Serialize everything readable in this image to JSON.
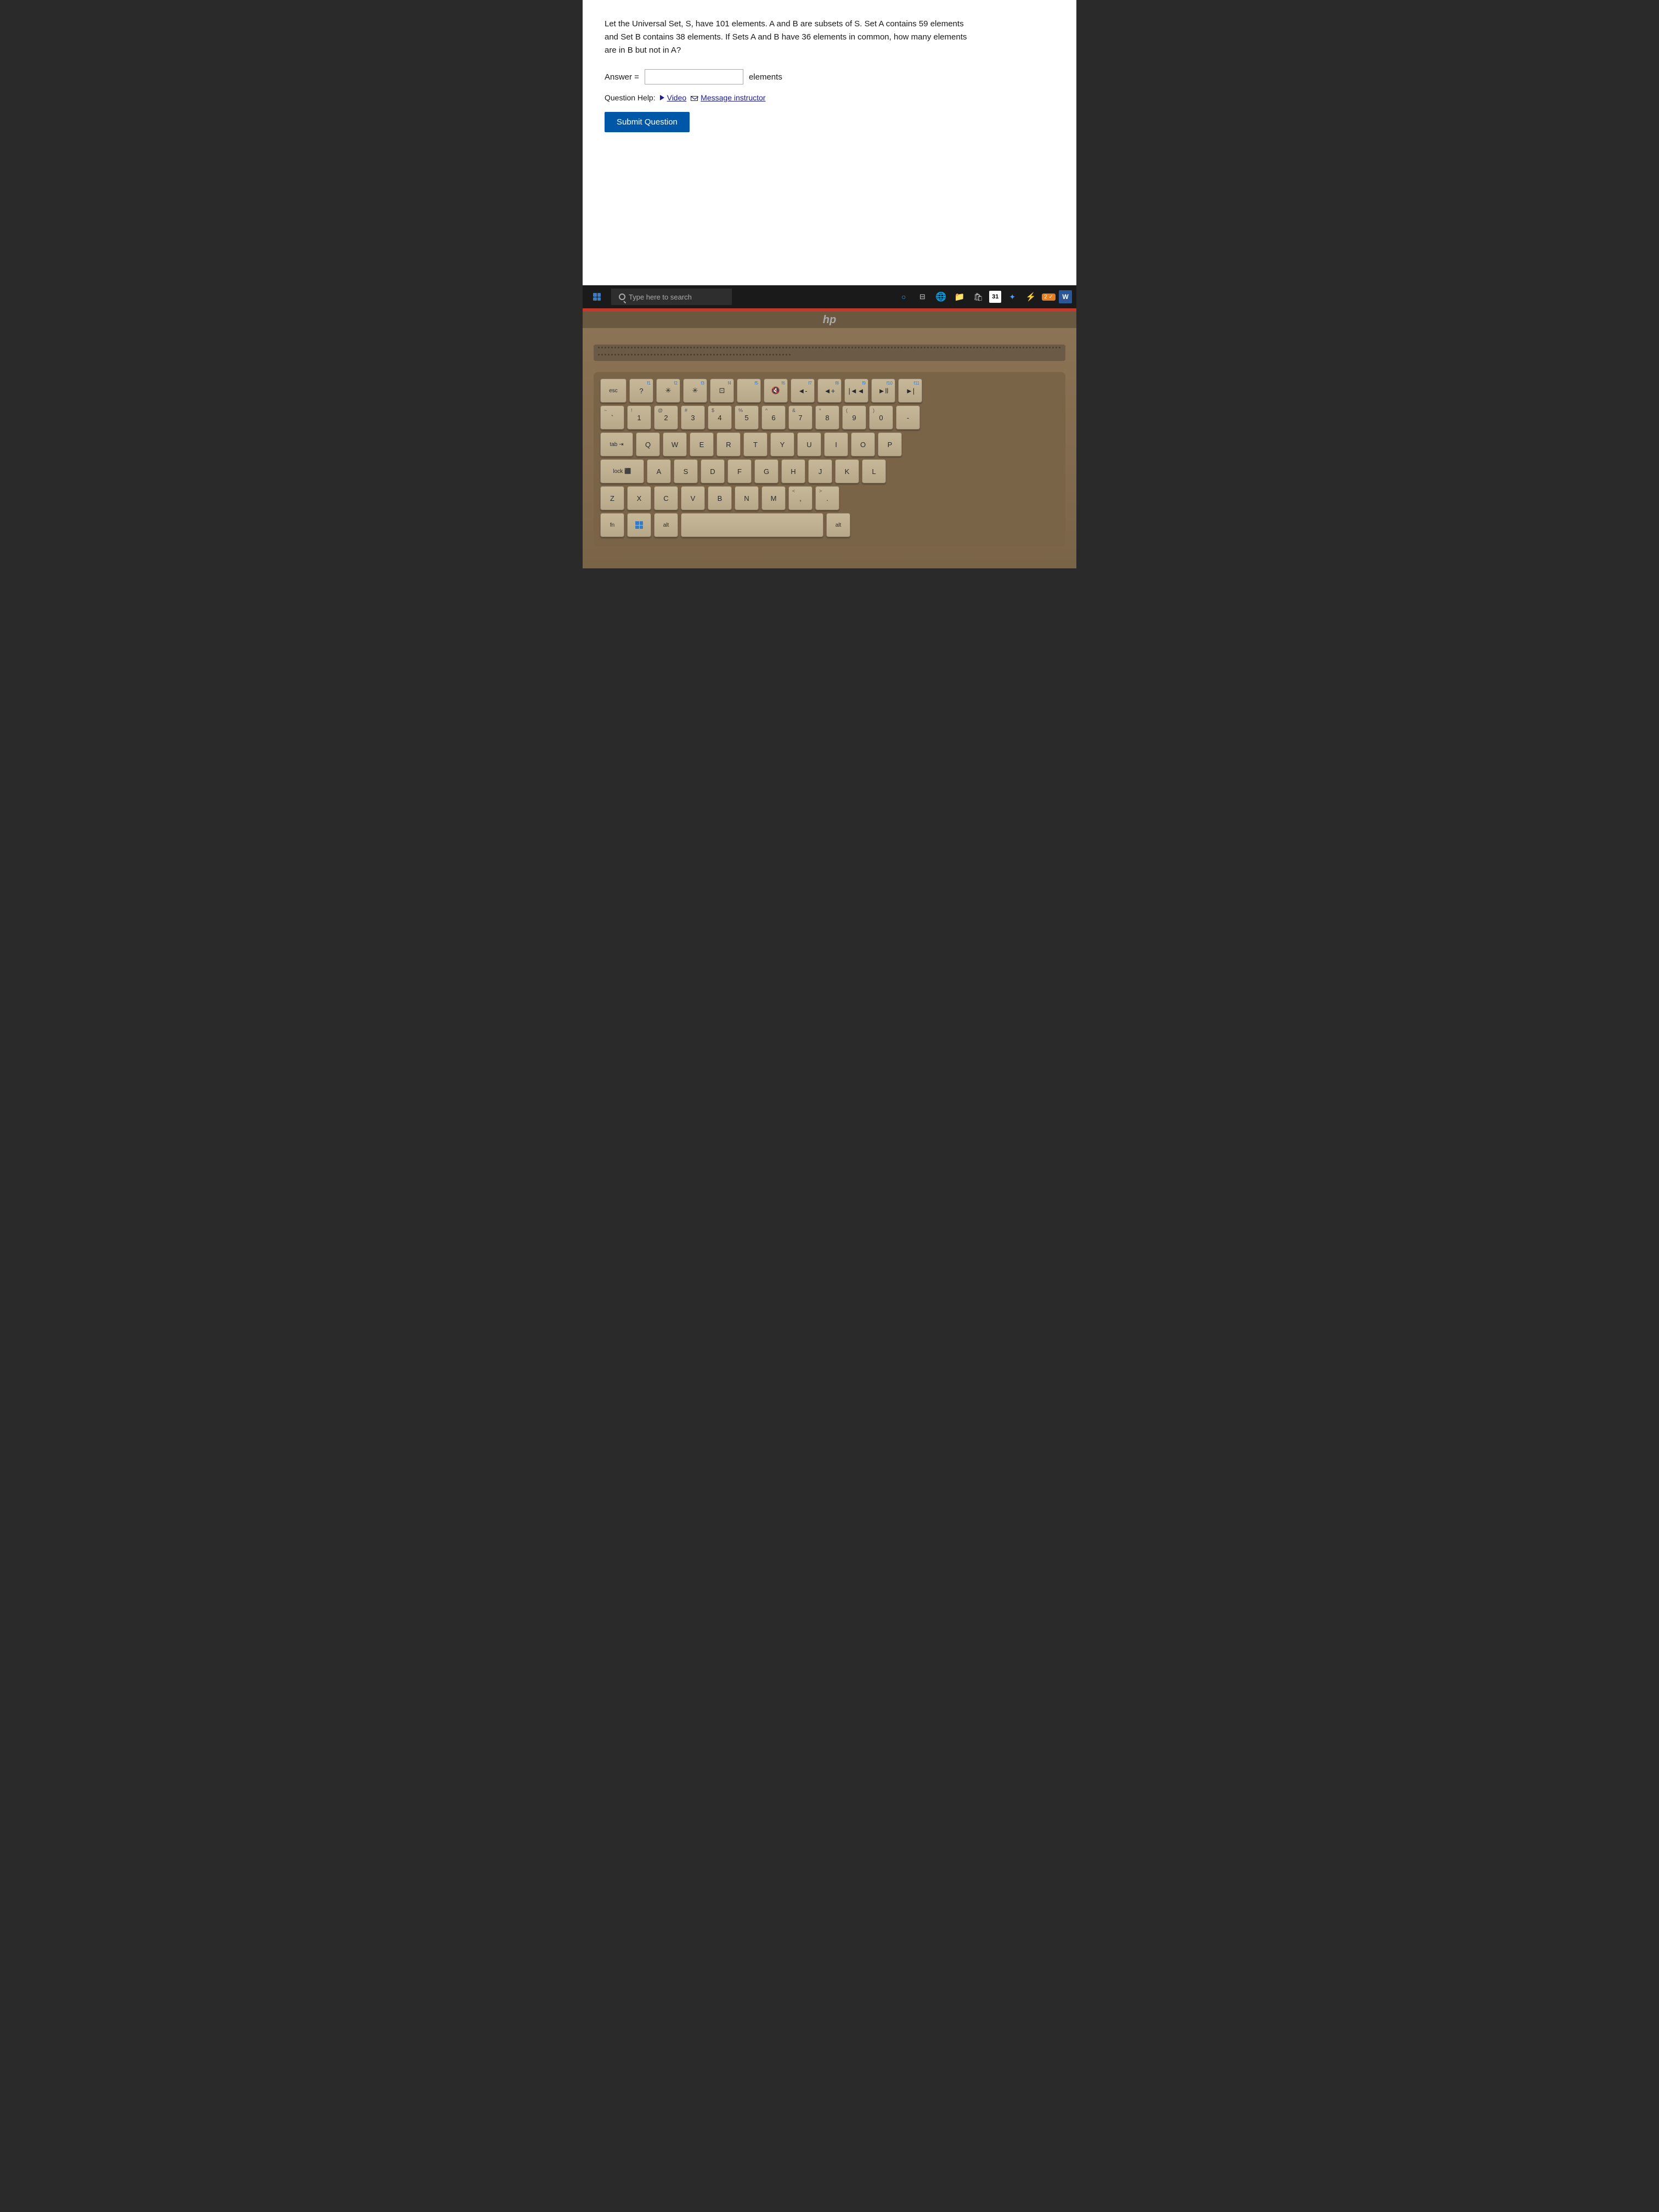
{
  "question": {
    "text": "Let the Universal Set, S, have 101 elements. A and B are subsets of S. Set A contains 59 elements and Set B contains 38 elements. If Sets A and B have 36 elements in common, how many elements are in B but not in A?",
    "answer_label": "Answer =",
    "answer_placeholder": "",
    "elements_suffix": "elements",
    "help_label": "Question Help:",
    "video_label": "Video",
    "message_label": "Message instructor",
    "submit_label": "Submit Question"
  },
  "taskbar": {
    "search_placeholder": "Type here to search",
    "calendar_number": "31",
    "badge_number": "2"
  },
  "keyboard": {
    "rows": [
      [
        "esc",
        "f1 ?",
        "f2 *",
        "f3 *",
        "f4 ⊡",
        "f5",
        "f6 🔇",
        "f7 ◄-",
        "f8 ◄+",
        "f9 |◄◄",
        "f10 ►ll",
        "f11 ►|"
      ],
      [
        "~ `",
        "! 1",
        "@ 2",
        "# 3",
        "$ 4",
        "% 5",
        "^ 6",
        "& 7",
        "* 8",
        "( 9",
        ") 0",
        "-"
      ],
      [
        "tab",
        "Q",
        "W",
        "E",
        "R",
        "T",
        "Y",
        "U",
        "I",
        "O",
        "P"
      ],
      [
        "lock",
        "A",
        "S",
        "D",
        "F",
        "G",
        "H",
        "J",
        "K",
        "L"
      ],
      [
        "Z",
        "X",
        "C",
        "V",
        "B",
        "N",
        "M",
        "<",
        ">"
      ],
      [
        "fn",
        "⊞",
        "alt",
        "",
        "alt"
      ]
    ]
  }
}
